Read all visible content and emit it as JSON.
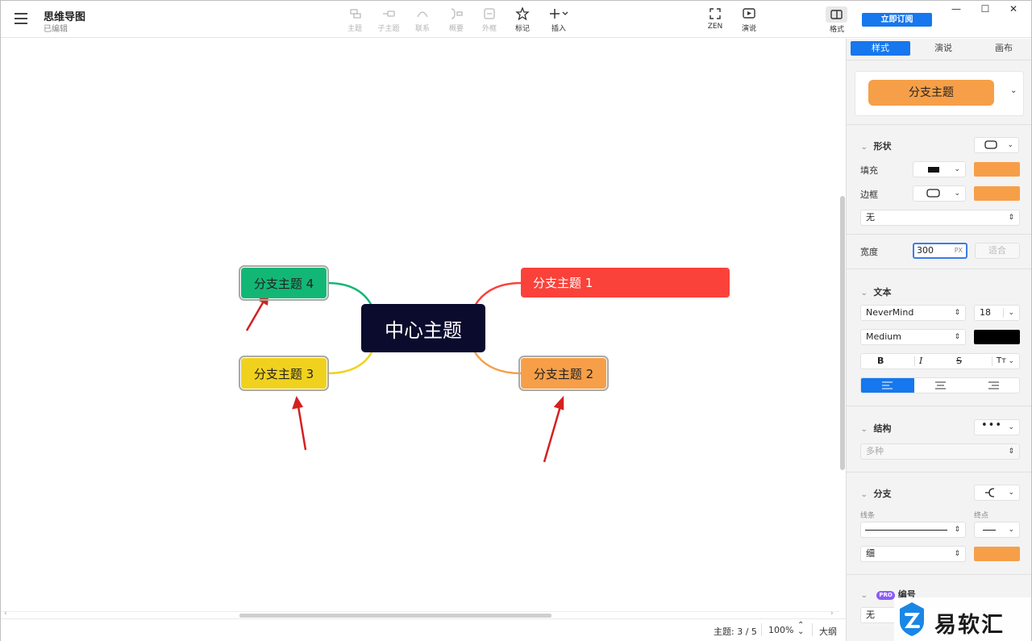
{
  "header": {
    "doc_title": "思维导图",
    "doc_status": "已编辑",
    "tools": [
      {
        "label": "主题",
        "icon": "topic-icon",
        "enabled": false
      },
      {
        "label": "子主题",
        "icon": "subtopic-icon",
        "enabled": false
      },
      {
        "label": "联系",
        "icon": "relationship-icon",
        "enabled": false
      },
      {
        "label": "概要",
        "icon": "summary-icon",
        "enabled": false
      },
      {
        "label": "外框",
        "icon": "boundary-icon",
        "enabled": false
      },
      {
        "label": "标记",
        "icon": "star-icon",
        "enabled": true
      },
      {
        "label": "插入",
        "icon": "plus-icon",
        "enabled": true
      },
      {
        "label": "ZEN",
        "icon": "fullscreen-icon",
        "enabled": true
      },
      {
        "label": "演说",
        "icon": "play-icon",
        "enabled": true
      }
    ],
    "format_label": "格式",
    "subscribe_label": "立即订阅",
    "window_controls": [
      "—",
      "☐",
      "✕"
    ]
  },
  "map": {
    "center": "中心主题",
    "branches": [
      {
        "label": "分支主题 1",
        "color": "#fa423a"
      },
      {
        "label": "分支主题 2",
        "color": "#f69f48"
      },
      {
        "label": "分支主题 3",
        "color": "#f0d21e"
      },
      {
        "label": "分支主题 4",
        "color": "#12b775"
      }
    ],
    "center_color": "#0b0b2d"
  },
  "status": {
    "topic_count": "主题: 3 / 5",
    "zoom": "100%",
    "outline_label": "大纲"
  },
  "panel": {
    "tabs": [
      "样式",
      "演说",
      "画布"
    ],
    "active_tab": "样式",
    "preview_label": "分支主题",
    "shape": {
      "title": "形状",
      "fill_label": "填充",
      "border_label": "边框",
      "border_style": "无",
      "fill_color": "#f69f48",
      "border_color": "#f69f48"
    },
    "width": {
      "label": "宽度",
      "value": "300",
      "unit": "PX",
      "fit_label": "适合"
    },
    "text": {
      "title": "文本",
      "font": "NeverMind",
      "size": "18",
      "weight": "Medium",
      "color": "#000000",
      "bold": "B",
      "italic": "I",
      "strike": "S",
      "case": "Tт"
    },
    "structure": {
      "title": "结构",
      "value": "多种"
    },
    "branch": {
      "title": "分支",
      "line_label": "线条",
      "end_label": "终点",
      "thickness": "细",
      "color": "#f69f48"
    },
    "numbering": {
      "badge": "PRO",
      "title": "编号",
      "value": "无"
    }
  },
  "watermark": "易软汇"
}
